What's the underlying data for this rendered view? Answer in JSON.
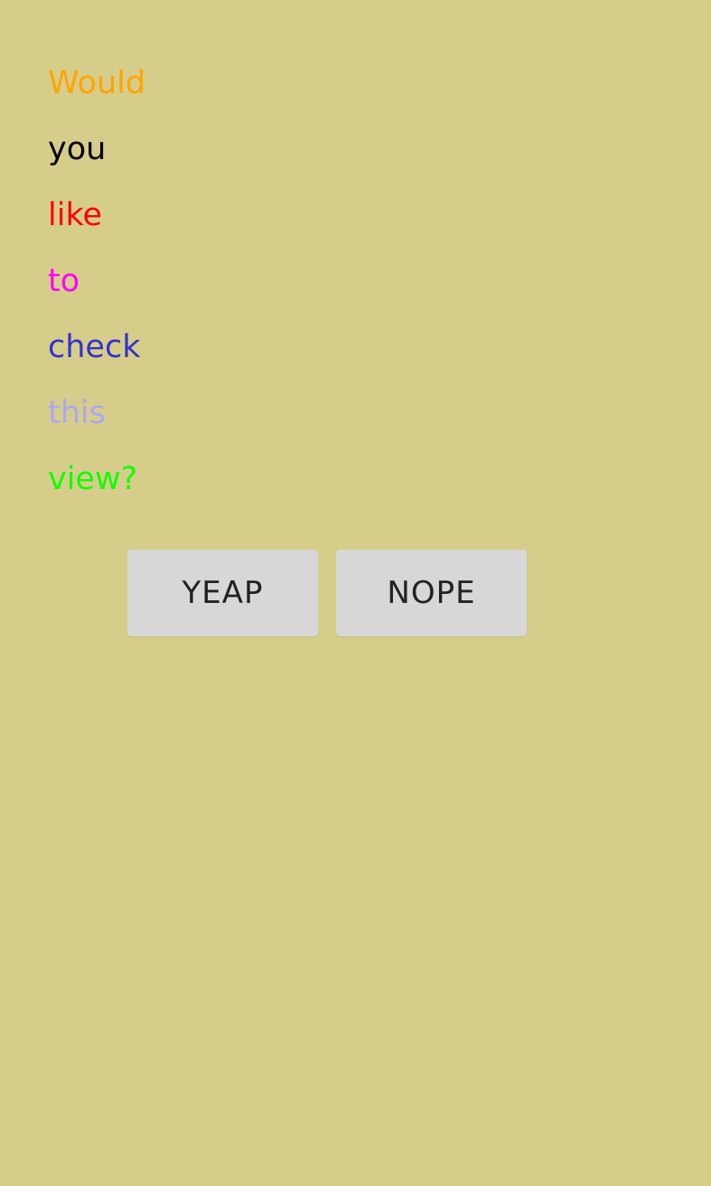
{
  "question": {
    "words": [
      {
        "text": "Would",
        "color": "#ffa500"
      },
      {
        "text": "you",
        "color": "#000000"
      },
      {
        "text": "like",
        "color": "#ff0000"
      },
      {
        "text": "to",
        "color": "#ff00ff"
      },
      {
        "text": "check",
        "color": "#3333cc"
      },
      {
        "text": "this",
        "color": "#a9a9f0"
      },
      {
        "text": "view?",
        "color": "#11ff00"
      }
    ]
  },
  "actions": {
    "yes_label": "YEAP",
    "no_label": "NOPE"
  },
  "colors": {
    "background": "#d7cd8b",
    "button_background": "#d6d7d6",
    "button_text": "#222222"
  }
}
